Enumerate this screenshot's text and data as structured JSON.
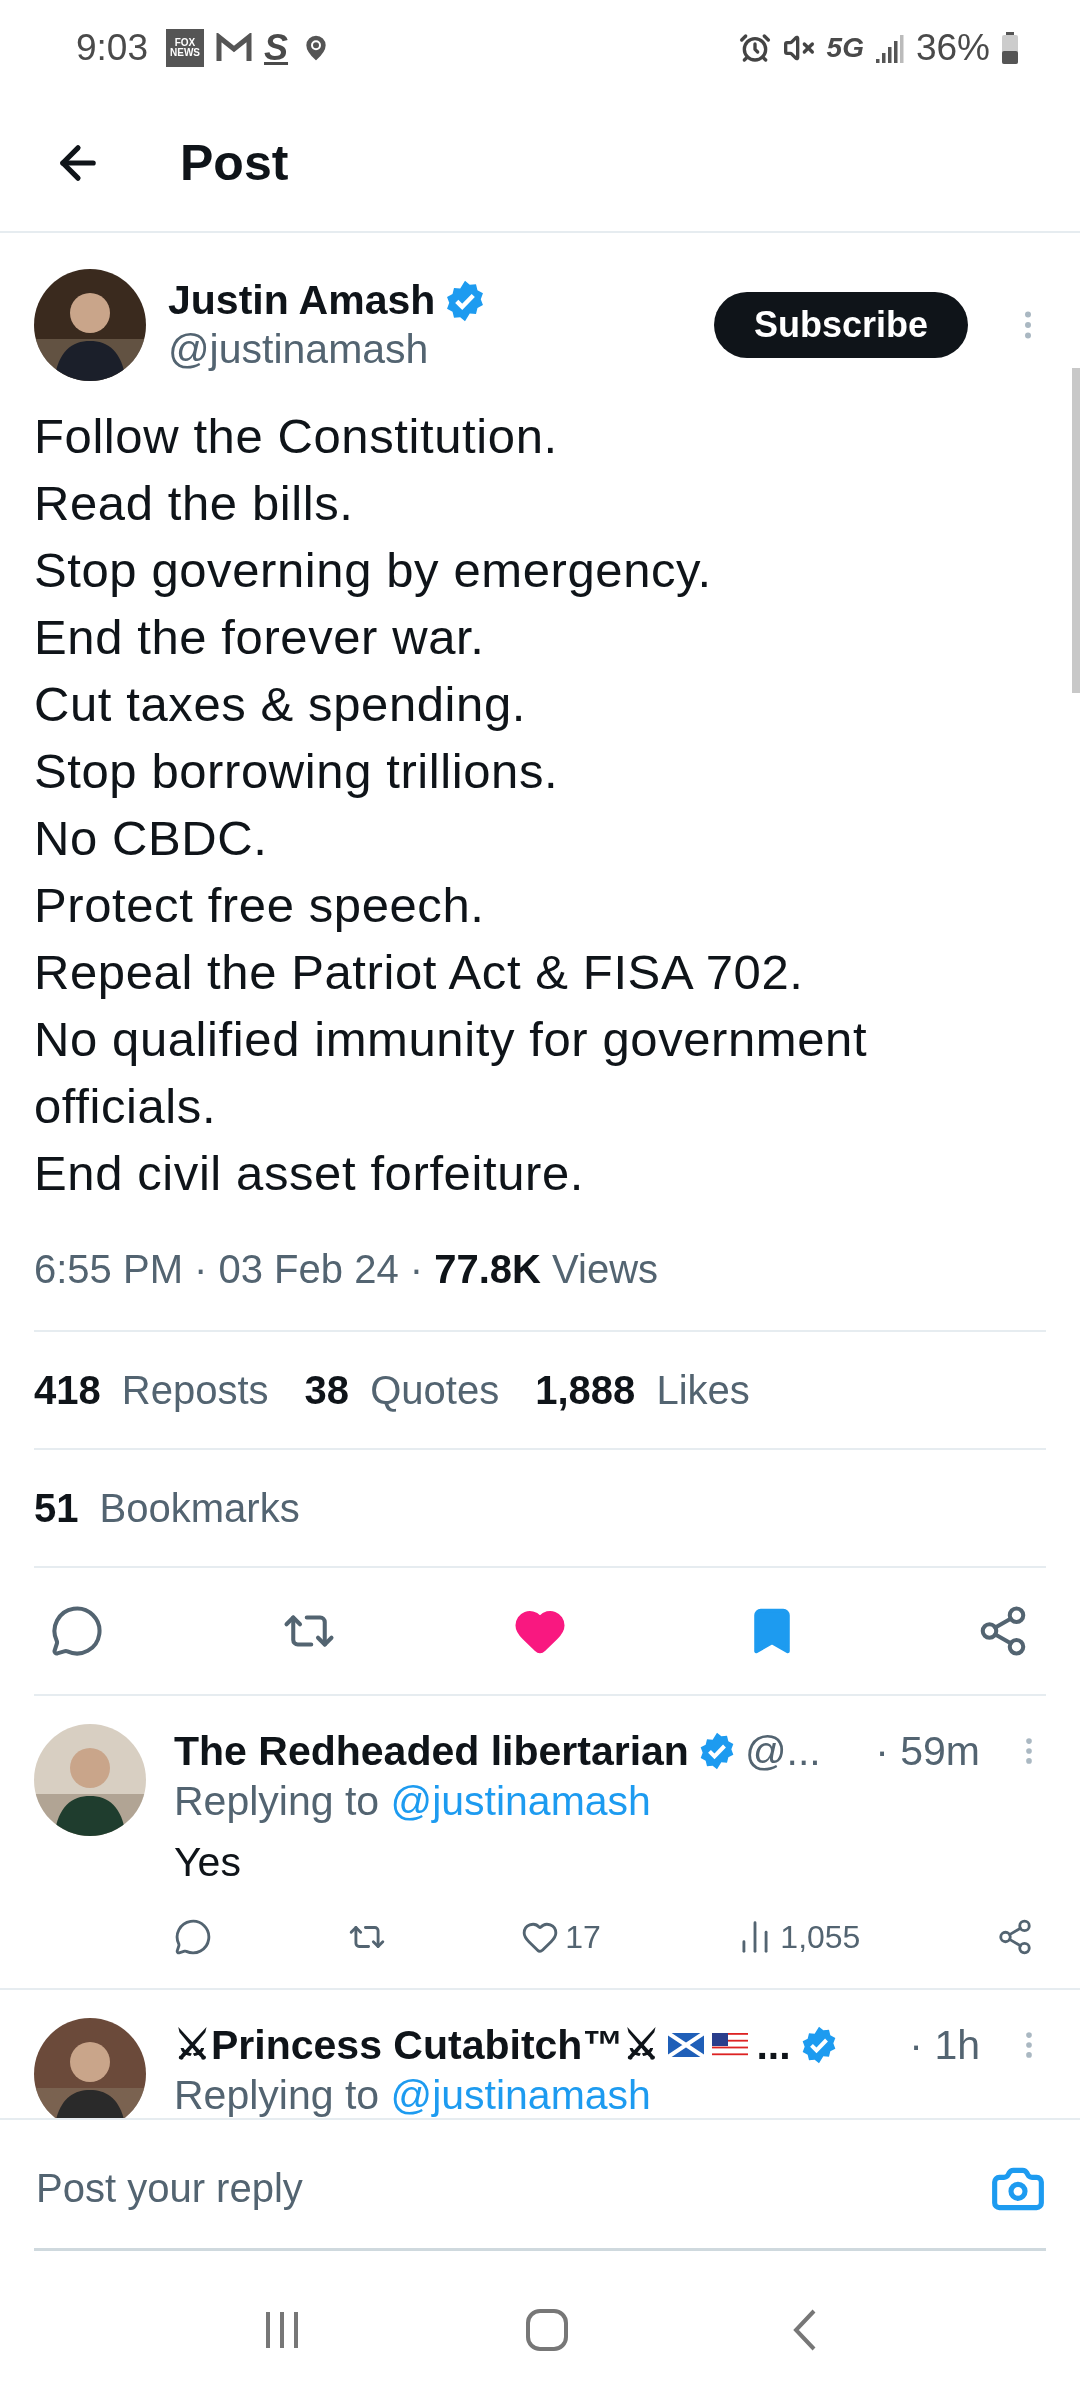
{
  "status_bar": {
    "time": "9:03",
    "notifications": [
      {
        "kind": "badge",
        "text": "FOX NEWS"
      },
      {
        "kind": "mail"
      },
      {
        "kind": "letter",
        "text": "S"
      },
      {
        "kind": "location"
      }
    ],
    "network": "5G",
    "battery": "36%"
  },
  "header": {
    "title": "Post"
  },
  "post": {
    "author": {
      "name": "Justin Amash",
      "handle": "@justinamash",
      "verified": true
    },
    "subscribe": "Subscribe",
    "text": "Follow the Constitution.\nRead the bills.\nStop governing by emergency.\nEnd the forever war.\nCut taxes & spending.\nStop borrowing trillions.\nNo CBDC.\nProtect free speech.\nRepeal the Patriot Act & FISA 702.\nNo qualified immunity for government officials.\nEnd civil asset forfeiture.",
    "meta": "6:55 PM · 03 Feb 24 · **77.8K** Views",
    "stats": [
      {
        "text": "**418** Reposts"
      },
      {
        "text": "**38** Quotes"
      },
      {
        "text": "**1,888** Likes"
      }
    ],
    "bookmarks": "**51** Bookmarks",
    "actions": [
      {
        "kind": "reply"
      },
      {
        "kind": "repost"
      },
      {
        "kind": "like",
        "active": true
      },
      {
        "kind": "bookmark",
        "active": true
      },
      {
        "kind": "share"
      }
    ]
  },
  "replies": [
    {
      "name": "The Redheaded libertarian",
      "verified": true,
      "handle": "@...",
      "time": "· 59m",
      "replying": "Replying to",
      "mention": "@justinamash",
      "text": "Yes",
      "actions": [
        {
          "kind": "reply"
        },
        {
          "kind": "repost"
        },
        {
          "kind": "like",
          "count": "17"
        },
        {
          "kind": "views",
          "count": "1,055"
        },
        {
          "kind": "share"
        }
      ]
    },
    {
      "name": "⚔Princess Cutabitch™⚔",
      "flags": [
        {
          "kind": "scotland"
        },
        {
          "kind": "usa"
        }
      ],
      "ellipsis": "...",
      "verified": true,
      "time": "· 1h",
      "replying": "Replying to",
      "mention": "@justinamash"
    }
  ],
  "composer": {
    "placeholder": "Post your reply"
  }
}
